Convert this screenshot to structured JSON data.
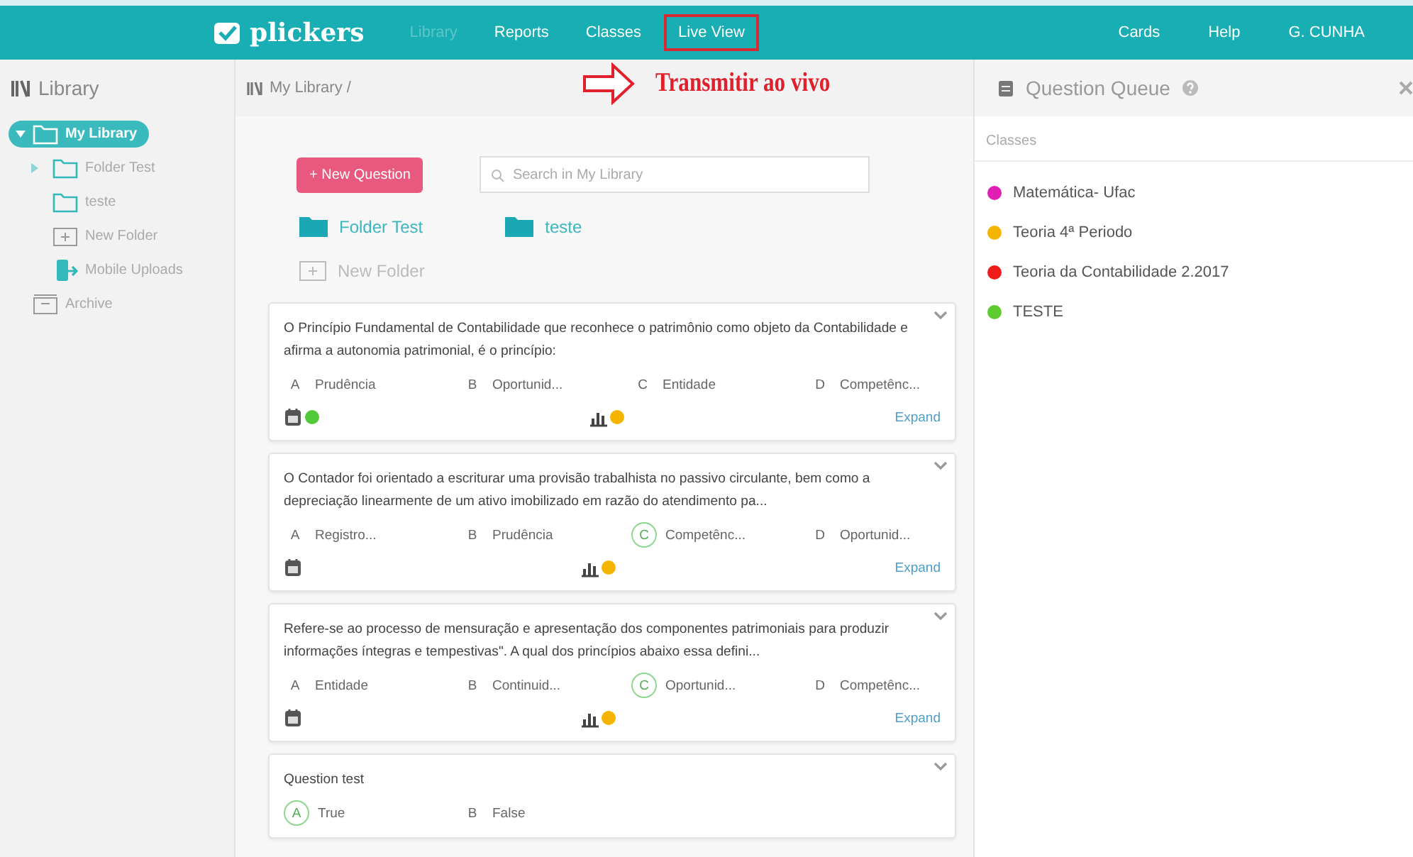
{
  "topbar": {
    "logo": "plickers",
    "tabs": [
      {
        "label": "Library",
        "selected": true,
        "highlighted": false
      },
      {
        "label": "Reports",
        "selected": false,
        "highlighted": false
      },
      {
        "label": "Classes",
        "selected": false,
        "highlighted": false
      },
      {
        "label": "Live View",
        "selected": false,
        "highlighted": true
      }
    ],
    "links": [
      "Cards",
      "Help",
      "G. CUNHA"
    ]
  },
  "annotation": {
    "caption": "Transmitir ao vivo"
  },
  "sidebar": {
    "title": "Library",
    "items": [
      {
        "label": "My Library",
        "kind": "folder",
        "selected": true,
        "expanded": true,
        "children": [
          {
            "label": "Folder Test",
            "kind": "folder",
            "selected": false,
            "expanded": false
          },
          {
            "label": "teste",
            "kind": "folder",
            "selected": false
          },
          {
            "label": "New Folder",
            "kind": "new-folder",
            "selected": false
          },
          {
            "label": "Mobile Uploads",
            "kind": "uploads",
            "selected": false
          }
        ]
      },
      {
        "label": "Archive",
        "kind": "archive",
        "selected": false
      }
    ]
  },
  "main": {
    "breadcrumb": "My Library /",
    "new_button": "+ New Question",
    "search": {
      "placeholder": "Search in My Library"
    },
    "folders": [
      "Folder Test",
      "teste"
    ],
    "new_folder": "New Folder",
    "cards": [
      {
        "text": "O Princípio Fundamental de Contabilidade que reconhece o patrimônio como objeto da Contabilidade e afirma a autonomia patrimonial, é o princípio:",
        "options": [
          {
            "letter": "A",
            "text": "Prudência",
            "correct": false
          },
          {
            "letter": "B",
            "text": "Oportunid...",
            "correct": false
          },
          {
            "letter": "C",
            "text": "Entidade",
            "correct": false
          },
          {
            "letter": "D",
            "text": "Competênc...",
            "correct": false
          }
        ],
        "queue_dot": {
          "color": "#52c936"
        },
        "report_dot": {
          "color": "#f5b400"
        },
        "expand": "Expand"
      },
      {
        "text": "O Contador foi orientado a escriturar uma provisão trabalhista no passivo circulante, bem como a depreciação linearmente de um ativo imobilizado em razão do atendimento pa...",
        "options": [
          {
            "letter": "A",
            "text": "Registro...",
            "correct": false
          },
          {
            "letter": "B",
            "text": "Prudência",
            "correct": false
          },
          {
            "letter": "C",
            "text": "Competênc...",
            "correct": true
          },
          {
            "letter": "D",
            "text": "Oportunid...",
            "correct": false
          }
        ],
        "report_dot": {
          "color": "#f5b400"
        },
        "expand": "Expand"
      },
      {
        "text": "Refere-se ao processo de mensuração e apresentação dos componentes patrimoniais para produzir informações íntegras e tempestivas\". A qual dos princípios abaixo essa defini...",
        "options": [
          {
            "letter": "A",
            "text": "Entidade",
            "correct": false
          },
          {
            "letter": "B",
            "text": "Continuid...",
            "correct": false
          },
          {
            "letter": "C",
            "text": "Oportunid...",
            "correct": true
          },
          {
            "letter": "D",
            "text": "Competênc...",
            "correct": false
          }
        ],
        "report_dot": {
          "color": "#f5b400"
        },
        "expand": "Expand"
      },
      {
        "text": "Question test",
        "options": [
          {
            "letter": "A",
            "text": "True",
            "correct": true
          },
          {
            "letter": "B",
            "text": "False",
            "correct": false
          }
        ]
      }
    ]
  },
  "queue": {
    "title": "Question Queue",
    "section": "Classes",
    "classes": [
      {
        "name": "Matemática- Ufac",
        "color": "#e020b4"
      },
      {
        "name": "Teoria 4ª Periodo",
        "color": "#f5b400"
      },
      {
        "name": "Teoria da Contabilidade 2.2017",
        "color": "#ee1c1c"
      },
      {
        "name": "TESTE",
        "color": "#5ccc2e"
      }
    ]
  }
}
